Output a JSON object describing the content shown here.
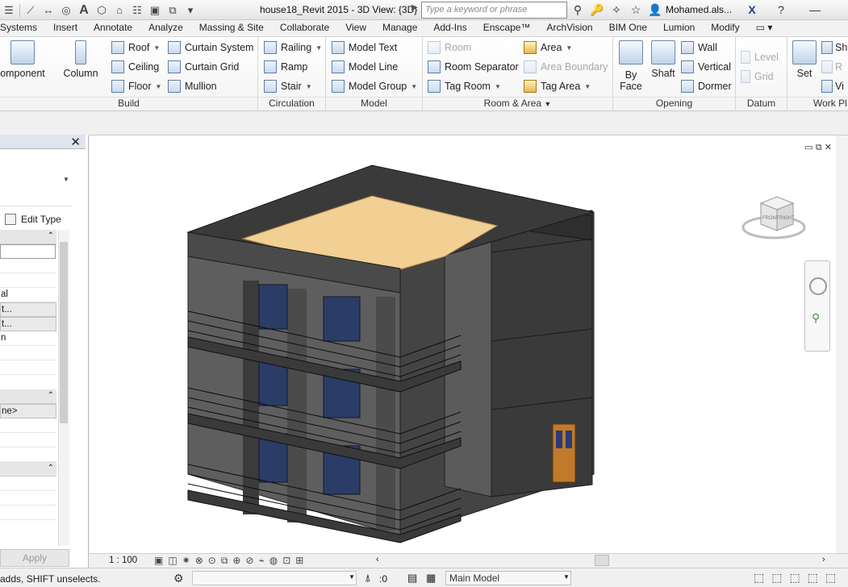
{
  "titlebar": {
    "doc_title": "house18_Revit 2015 - 3D View: {3D}",
    "search_placeholder": "Type a keyword or phrase",
    "user_name": "Mohamed.als..."
  },
  "tabs": [
    "Systems",
    "Insert",
    "Annotate",
    "Analyze",
    "Massing & Site",
    "Collaborate",
    "View",
    "Manage",
    "Add-Ins",
    "Enscape™",
    "ArchVision",
    "BIM One",
    "Lumion",
    "Modify"
  ],
  "ribbon": {
    "build": {
      "title": "Build",
      "component": "omponent",
      "column": "Column",
      "roof": "Roof",
      "ceiling": "Ceiling",
      "floor": "Floor",
      "curtain_system": "Curtain System",
      "curtain_grid": "Curtain Grid",
      "mullion": "Mullion"
    },
    "circulation": {
      "title": "Circulation",
      "railing": "Railing",
      "ramp": "Ramp",
      "stair": "Stair"
    },
    "model": {
      "title": "Model",
      "model_text": "Model Text",
      "model_line": "Model Line",
      "model_group": "Model Group"
    },
    "room_area": {
      "title": "Room & Area",
      "room": "Room",
      "room_separator": "Room Separator",
      "tag_room": "Tag Room",
      "area": "Area",
      "area_boundary": "Area Boundary",
      "tag_area": "Tag Area"
    },
    "opening": {
      "title": "Opening",
      "by_face_1": "By",
      "by_face_2": "Face",
      "shaft": "Shaft",
      "wall": "Wall",
      "vertical": "Vertical",
      "dormer": "Dormer"
    },
    "datum": {
      "title": "Datum",
      "level": "Level",
      "grid": "Grid"
    },
    "workplane": {
      "title": "Work Pl",
      "set": "Set",
      "s_cut": "Sh",
      "r_cut": "R",
      "v_cut": "Vi"
    }
  },
  "properties": {
    "edit_type": "Edit Type",
    "rows": [
      "",
      "",
      "",
      "al",
      "t...",
      "t...",
      "n",
      "",
      "",
      "ne>",
      "",
      "",
      "",
      "",
      "",
      ""
    ],
    "apply": "Apply"
  },
  "view": {
    "scale": "1 : 100",
    "viewcube_front": "FRONT",
    "viewcube_right": "RIGHT"
  },
  "status": {
    "text": "adds, SHIFT unselects.",
    "zero": ":0",
    "model": "Main Model"
  }
}
